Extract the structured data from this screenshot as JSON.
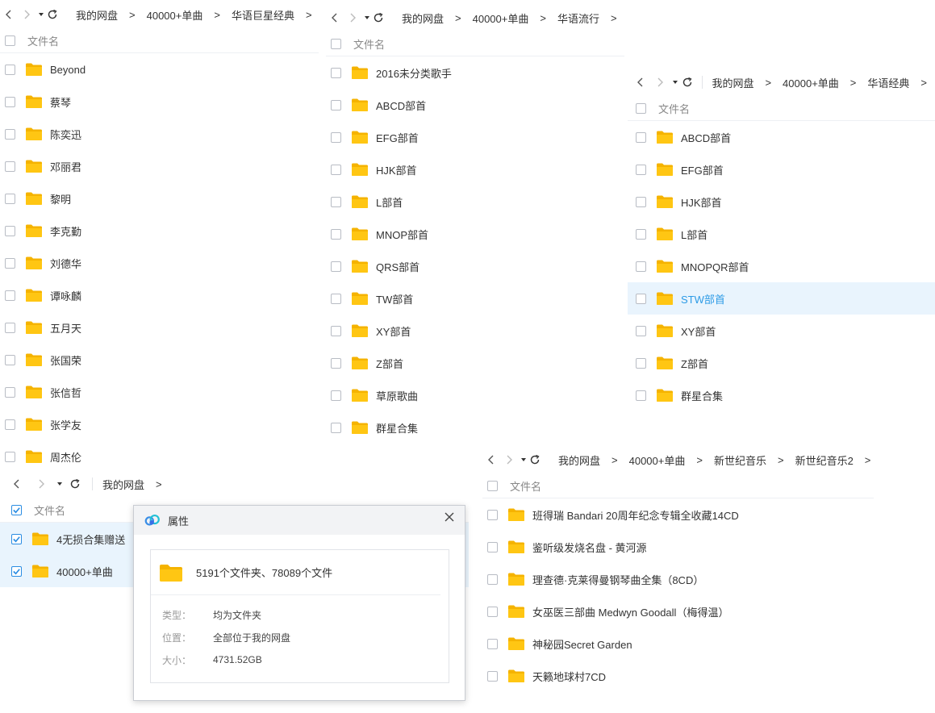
{
  "colors": {
    "folder": "#ffc613",
    "folder_tab": "#f5b300",
    "accent": "#2d9be6",
    "highlight_bg": "#e9f4fd"
  },
  "icons": [
    "back-icon",
    "forward-icon",
    "dropdown-icon",
    "refresh-icon",
    "folder-icon",
    "checkbox-icon",
    "close-icon",
    "cloud-logo-icon"
  ],
  "header": {
    "filename": "文件名"
  },
  "panel1": {
    "breadcrumb": [
      "我的网盘",
      "40000+单曲",
      "华语巨星经典"
    ],
    "sep": ">",
    "items": [
      "Beyond",
      "蔡琴",
      "陈奕迅",
      "邓丽君",
      "黎明",
      "李克勤",
      "刘德华",
      "谭咏麟",
      "五月天",
      "张国荣",
      "张信哲",
      "张学友",
      "周杰伦"
    ]
  },
  "panel2": {
    "breadcrumb": [
      "我的网盘",
      "40000+单曲",
      "华语流行"
    ],
    "sep": ">",
    "items": [
      "2016未分类歌手",
      "ABCD部首",
      "EFG部首",
      "HJK部首",
      "L部首",
      "MNOP部首",
      "QRS部首",
      "TW部首",
      "XY部首",
      "Z部首",
      "草原歌曲",
      "群星合集"
    ]
  },
  "panel3": {
    "breadcrumb": [
      "我的网盘",
      "40000+单曲",
      "华语经典"
    ],
    "sep": ">",
    "items": [
      "ABCD部首",
      "EFG部首",
      "HJK部首",
      "L部首",
      "MNOPQR部首",
      "STW部首",
      "XY部首",
      "Z部首",
      "群星合集"
    ],
    "highlighted_item": "STW部首"
  },
  "panel4": {
    "breadcrumb": [
      "我的网盘"
    ],
    "sep": ">",
    "items": [
      "4无损合集赠送",
      "40000+单曲"
    ],
    "all_checked": true
  },
  "panel5": {
    "breadcrumb": [
      "我的网盘",
      "40000+单曲",
      "新世纪音乐",
      "新世纪音乐2"
    ],
    "sep": ">",
    "items": [
      "班得瑞 Bandari 20周年纪念专辑全收藏14CD",
      "鉴听级发烧名盘 - 黄河源",
      "理查德·克莱得曼钢琴曲全集（8CD）",
      "女巫医三部曲 Medwyn Goodall（梅得温）",
      "神秘园Secret Garden",
      "天籁地球村7CD"
    ]
  },
  "dialog": {
    "title": "属性",
    "summary": "5191个文件夹、78089个文件",
    "type_label": "类型：",
    "type_value": "均为文件夹",
    "location_label": "位置：",
    "location_value": "全部位于我的网盘",
    "size_label": "大小：",
    "size_value": "4731.52GB"
  }
}
